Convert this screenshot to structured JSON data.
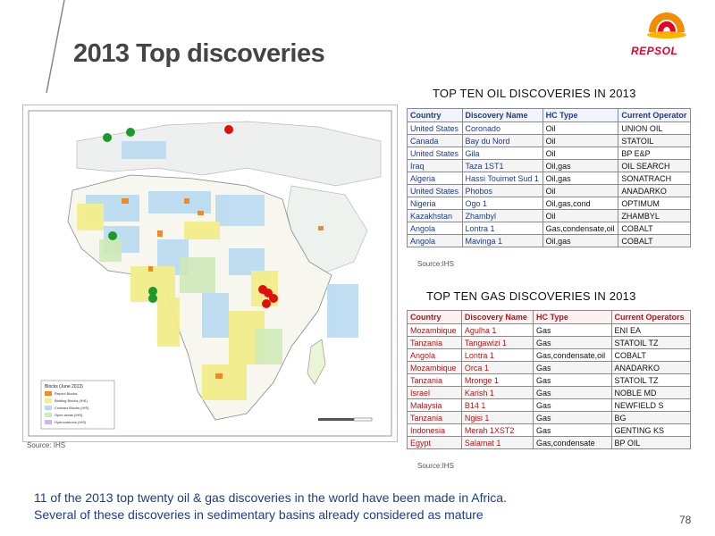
{
  "slide": {
    "title": "2013 Top discoveries",
    "page_number": "78",
    "logo_text": "REPSOL",
    "footer_line1": "11 of the 2013 top twenty oil & gas discoveries in the world have been made in Africa.",
    "footer_line2": "Several of these discoveries in sedimentary basins already considered as mature"
  },
  "map": {
    "source": "Source: IHS",
    "legend_title": "Blocks (June 2013)",
    "legend_items": [
      "Repsol Blocks",
      "Bidding Blocks (IHS)",
      "Contract Blocks (IHS)",
      "Open areas (IHS)",
      "Hydrocarbons (IHS)"
    ],
    "marker_colors": {
      "oil": "#1a9a2a",
      "gas": "#e01010"
    }
  },
  "oil_table": {
    "title": "TOP TEN OIL DISCOVERIES IN 2013",
    "source": "Source:IHS",
    "headers": [
      "Country",
      "Discovery Name",
      "HC Type",
      "Current Operator"
    ],
    "rows": [
      [
        "United States",
        "Coronado",
        "Oil",
        "UNION OIL"
      ],
      [
        "Canada",
        "Bay du Nord",
        "Oil",
        "STATOIL"
      ],
      [
        "United States",
        "Gila",
        "Oil",
        "BP E&P"
      ],
      [
        "Iraq",
        "Taza 1ST1",
        "Oil,gas",
        "OIL SEARCH"
      ],
      [
        "Algeria",
        "Hassi Touimet Sud 1",
        "Oil,gas",
        "SONATRACH"
      ],
      [
        "United States",
        "Phobos",
        "Oil",
        "ANADARKO"
      ],
      [
        "Nigeria",
        "Ogo 1",
        "Oil,gas,cond",
        "OPTIMUM"
      ],
      [
        "Kazakhstan",
        "Zhambyl",
        "Oil",
        "ZHAMBYL"
      ],
      [
        "Angola",
        "Lontra 1",
        "Gas,condensate,oil",
        "COBALT"
      ],
      [
        "Angola",
        "Mavinga 1",
        "Oil,gas",
        "COBALT"
      ]
    ]
  },
  "gas_table": {
    "title": "TOP TEN GAS DISCOVERIES IN 2013",
    "source": "Source:IHS",
    "headers": [
      "Country",
      "Discovery Name",
      "HC Type",
      "Current Operators"
    ],
    "rows": [
      [
        "Mozambique",
        "Agulha 1",
        "Gas",
        "ENI EA"
      ],
      [
        "Tanzania",
        "Tangawizi 1",
        "Gas",
        "STATOIL TZ"
      ],
      [
        "Angola",
        "Lontra 1",
        "Gas,condensate,oil",
        "COBALT"
      ],
      [
        "Mozambique",
        "Orca 1",
        "Gas",
        "ANADARKO"
      ],
      [
        "Tanzania",
        "Mronge 1",
        "Gas",
        "STATOIL TZ"
      ],
      [
        "Israel",
        "Karish 1",
        "Gas",
        "NOBLE MD"
      ],
      [
        "Malaysia",
        "B14 1",
        "Gas",
        "NEWFIELD S"
      ],
      [
        "Tanzania",
        "Ngisi 1",
        "Gas",
        "BG"
      ],
      [
        "Indonesia",
        "Merah 1XST2",
        "Gas",
        "GENTING KS"
      ],
      [
        "Egypt",
        "Salamat 1",
        "Gas,condensate",
        "BP OIL"
      ]
    ]
  }
}
